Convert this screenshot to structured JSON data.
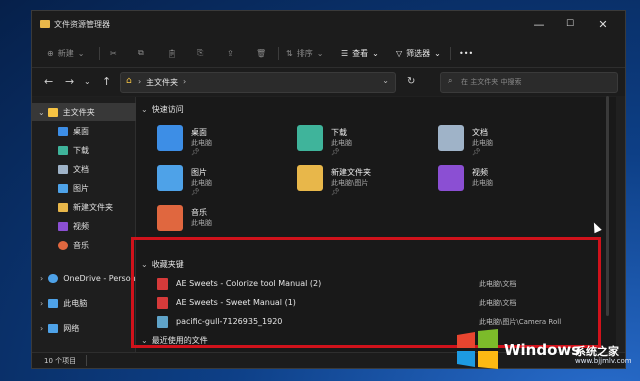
{
  "window": {
    "title": "文件资源管理器",
    "min": "—",
    "max": "☐",
    "close": "✕"
  },
  "toolbar": {
    "new": "新建",
    "sort": "排序",
    "view": "查看",
    "filter": "筛选器",
    "more": "•••"
  },
  "address": {
    "path": "主文件夹",
    "search_placeholder": "在 主文件夹 中搜索"
  },
  "sidebar": {
    "items": [
      {
        "label": "主文件夹",
        "icon": "home-icon",
        "color": "#f6c343"
      },
      {
        "label": "桌面",
        "icon": "desktop-icon",
        "color": "#3d8ee6"
      },
      {
        "label": "下载",
        "icon": "download-icon",
        "color": "#3fb49b"
      },
      {
        "label": "文档",
        "icon": "document-icon",
        "color": "#9fb3c8"
      },
      {
        "label": "图片",
        "icon": "pictures-icon",
        "color": "#4ea2e8"
      },
      {
        "label": "新建文件夹",
        "icon": "folder-icon",
        "color": "#e8b74a"
      },
      {
        "label": "视频",
        "icon": "videos-icon",
        "color": "#8b4fd3"
      },
      {
        "label": "音乐",
        "icon": "music-icon",
        "color": "#e0673f"
      },
      {
        "label": "OneDrive - Person",
        "icon": "onedrive-icon",
        "color": "#4ea2e8"
      },
      {
        "label": "此电脑",
        "icon": "this-pc-icon",
        "color": "#4ea2e8"
      },
      {
        "label": "网络",
        "icon": "network-icon",
        "color": "#4ea2e8"
      }
    ]
  },
  "quick_access": {
    "title": "快速访问",
    "items": [
      {
        "name": "桌面",
        "sub": "此电脑",
        "color": "#3d8ee6",
        "icon": "desktop-folder-icon"
      },
      {
        "name": "下载",
        "sub": "此电脑",
        "color": "#3fb49b",
        "icon": "download-folder-icon"
      },
      {
        "name": "文档",
        "sub": "此电脑",
        "color": "#9fb3c8",
        "icon": "documents-folder-icon"
      },
      {
        "name": "图片",
        "sub": "此电脑",
        "color": "#4ea2e8",
        "icon": "pictures-folder-icon"
      },
      {
        "name": "新建文件夹",
        "sub": "此电脑\\图片",
        "color": "#e8b74a",
        "icon": "folder-icon"
      },
      {
        "name": "视频",
        "sub": "此电脑",
        "color": "#8b4fd3",
        "icon": "videos-folder-icon"
      },
      {
        "name": "音乐",
        "sub": "此电脑",
        "color": "#e0673f",
        "icon": "music-folder-icon"
      }
    ]
  },
  "favorites": {
    "title": "收藏夹键",
    "files": [
      {
        "name": "AE Sweets - Colorize tool Manual (2)",
        "location": "此电脑\\文档",
        "icon": "pdf-icon",
        "color": "#d63a3a"
      },
      {
        "name": "AE Sweets - Sweet Manual (1)",
        "location": "此电脑\\文档",
        "icon": "pdf-icon",
        "color": "#d63a3a"
      },
      {
        "name": "pacific-gull-7126935_1920",
        "location": "此电脑\\图片\\Camera Roll",
        "icon": "image-icon",
        "color": "#5fa3c8"
      }
    ]
  },
  "recent": {
    "title": "最近使用的文件"
  },
  "status": {
    "count": "10 个项目"
  },
  "watermark": {
    "brand": "Windows",
    "brand_cn": "系统之家",
    "url": "www.bjjmlv.com"
  },
  "colors": {
    "highlight": "#d0121b",
    "bg": "#202020"
  }
}
